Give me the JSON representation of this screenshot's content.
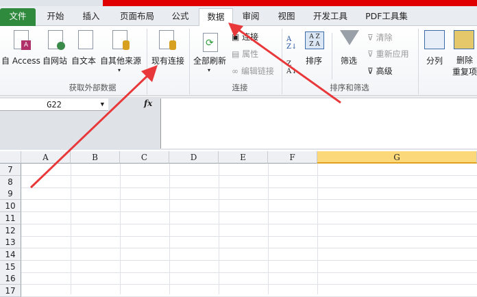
{
  "tabs": [
    "文件",
    "开始",
    "插入",
    "页面布局",
    "公式",
    "数据",
    "审阅",
    "视图",
    "开发工具",
    "PDF工具集"
  ],
  "active_tab": "数据",
  "ribbon": {
    "get_external": {
      "items": [
        "自 Access",
        "自网站",
        "自文本",
        "自其他来源",
        "现有连接"
      ],
      "group": "获取外部数据"
    },
    "connections": {
      "refresh_all": "全部刷新",
      "items": [
        "连接",
        "属性",
        "编辑链接"
      ],
      "group": "连接"
    },
    "sort_filter": {
      "sort": "排序",
      "filter": "筛选",
      "clear": "清除",
      "reapply": "重新应用",
      "advanced": "高级",
      "group": "排序和筛选"
    },
    "tools": {
      "split": "分列",
      "remove_dup": "删除\n重复项"
    }
  },
  "name_box": "G22",
  "fx": "fx",
  "columns": [
    "A",
    "B",
    "C",
    "D",
    "E",
    "F",
    "G"
  ],
  "selected_column": "G",
  "rows": [
    "7",
    "8",
    "9",
    "10",
    "11",
    "12",
    "13",
    "14",
    "15",
    "16",
    "17"
  ],
  "colors": {
    "file_tab": "#2f8a3e",
    "title_bar": "#e00000",
    "arrow": "#e8383a",
    "selected_header": "#fbd97a"
  }
}
